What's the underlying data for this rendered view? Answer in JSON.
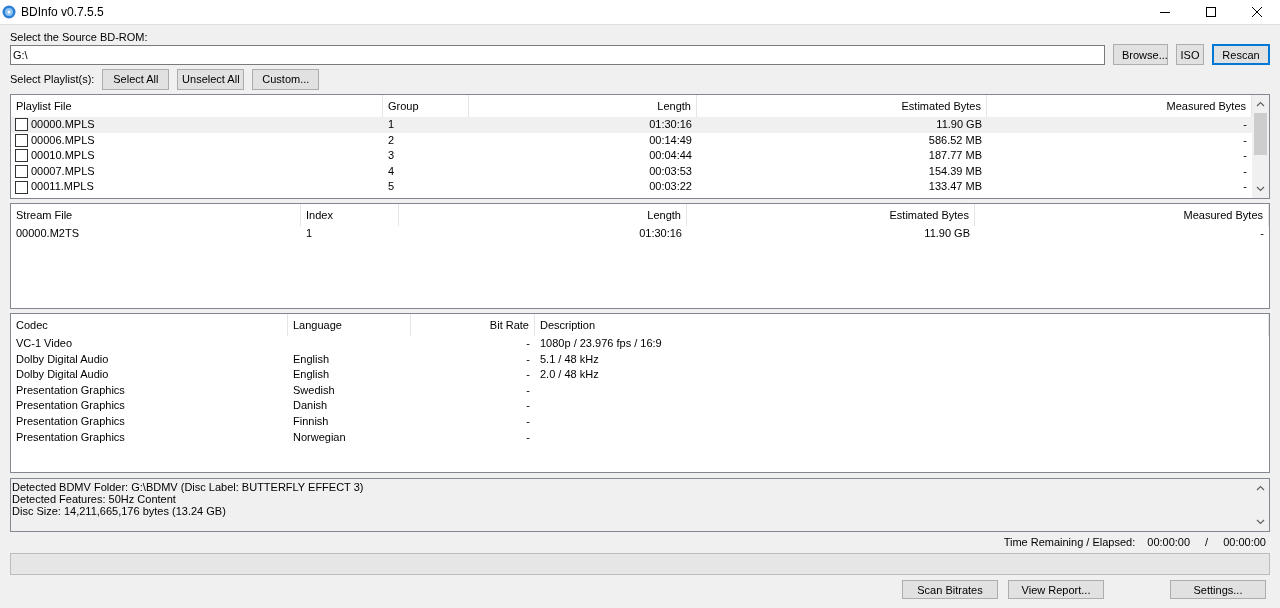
{
  "window": {
    "title": "BDInfo v0.7.5.5"
  },
  "source": {
    "label": "Select the Source BD-ROM:",
    "value": "G:\\",
    "buttons": [
      {
        "label": "Browse...",
        "focused": false
      },
      {
        "label": "ISO",
        "focused": false
      },
      {
        "label": "Rescan",
        "focused": true
      }
    ]
  },
  "playlist_select": {
    "label": "Select Playlist(s):",
    "buttons": [
      "Select All",
      "Unselect All",
      "Custom..."
    ]
  },
  "playlists": {
    "columns": [
      "Playlist File",
      "Group",
      "Length",
      "Estimated Bytes",
      "Measured Bytes"
    ],
    "rows": [
      {
        "file": "00000.MPLS",
        "checked": false,
        "selected": true,
        "group": "1",
        "length": "01:30:16",
        "estimated": "11.90 GB",
        "measured": "-"
      },
      {
        "file": "00006.MPLS",
        "checked": false,
        "selected": false,
        "group": "2",
        "length": "00:14:49",
        "estimated": "586.52 MB",
        "measured": "-"
      },
      {
        "file": "00010.MPLS",
        "checked": false,
        "selected": false,
        "group": "3",
        "length": "00:04:44",
        "estimated": "187.77 MB",
        "measured": "-"
      },
      {
        "file": "00007.MPLS",
        "checked": false,
        "selected": false,
        "group": "4",
        "length": "00:03:53",
        "estimated": "154.39 MB",
        "measured": "-"
      },
      {
        "file": "00011.MPLS",
        "checked": false,
        "selected": false,
        "group": "5",
        "length": "00:03:22",
        "estimated": "133.47 MB",
        "measured": "-"
      }
    ]
  },
  "streams": {
    "columns": [
      "Stream File",
      "Index",
      "Length",
      "Estimated Bytes",
      "Measured Bytes"
    ],
    "rows": [
      [
        "00000.M2TS",
        "1",
        "01:30:16",
        "11.90 GB",
        "-"
      ]
    ]
  },
  "codecs": {
    "columns": [
      "Codec",
      "Language",
      "Bit Rate",
      "Description"
    ],
    "rows": [
      [
        "VC-1 Video",
        "",
        "-",
        "1080p / 23.976 fps / 16:9"
      ],
      [
        "Dolby Digital Audio",
        "English",
        "-",
        "5.1 / 48 kHz"
      ],
      [
        "Dolby Digital Audio",
        "English",
        "-",
        "2.0 / 48 kHz"
      ],
      [
        "Presentation Graphics",
        "Swedish",
        "-",
        ""
      ],
      [
        "Presentation Graphics",
        "Danish",
        "-",
        ""
      ],
      [
        "Presentation Graphics",
        "Finnish",
        "-",
        ""
      ],
      [
        "Presentation Graphics",
        "Norwegian",
        "-",
        ""
      ]
    ]
  },
  "info": {
    "lines": [
      "Detected BDMV Folder: G:\\BDMV (Disc Label: BUTTERFLY EFFECT 3)",
      "Detected Features: 50Hz Content",
      "Disc Size: 14,211,665,176 bytes (13.24 GB)"
    ]
  },
  "time": {
    "label": "Time Remaining / Elapsed:",
    "remaining": "00:00:00",
    "separator": "/",
    "elapsed": "00:00:00"
  },
  "progress": {
    "level": 0
  },
  "buttons": [
    "Scan Bitrates",
    "View Report...",
    "Settings..."
  ]
}
